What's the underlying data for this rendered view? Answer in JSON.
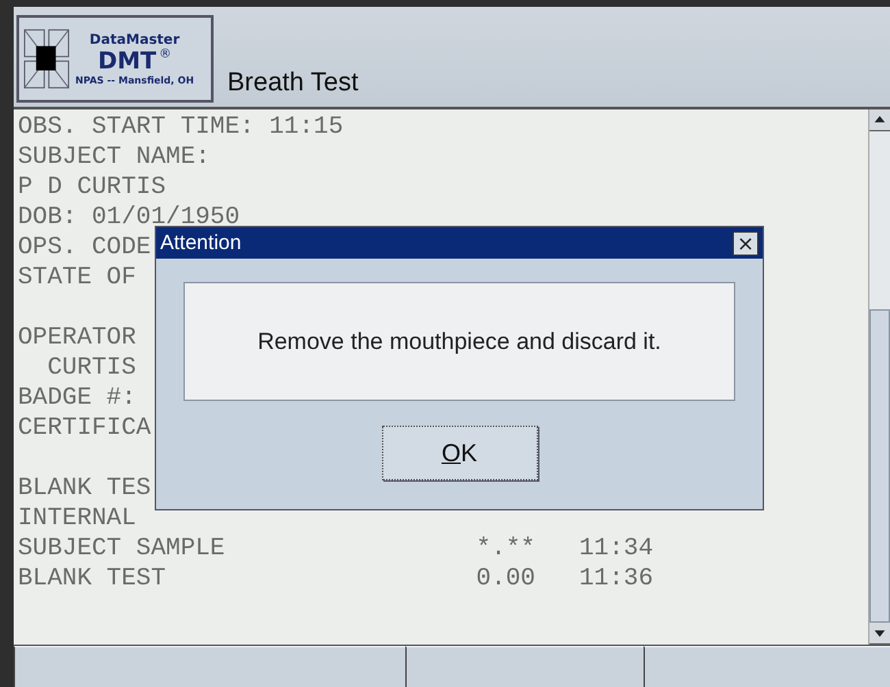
{
  "header": {
    "logo": {
      "brand": "DataMaster",
      "model": "DMT",
      "mark": "®",
      "location": "NPAS -- Mansfield, OH"
    },
    "title": "Breath Test"
  },
  "report": {
    "lines": [
      {
        "kind": "text",
        "label": "OBS. START TIME: 11:15"
      },
      {
        "kind": "text",
        "label": "SUBJECT NAME:"
      },
      {
        "kind": "text",
        "label": "P D CURTIS"
      },
      {
        "kind": "text",
        "label": "DOB: 01/01/1950"
      },
      {
        "kind": "text",
        "label": "OPS. CODE"
      },
      {
        "kind": "text",
        "label": "STATE OF"
      },
      {
        "kind": "blank"
      },
      {
        "kind": "text",
        "label": "OPERATOR"
      },
      {
        "kind": "text",
        "label": "  CURTIS"
      },
      {
        "kind": "text",
        "label": "BADGE #:"
      },
      {
        "kind": "text",
        "label": "CERTIFICA"
      },
      {
        "kind": "blank"
      },
      {
        "kind": "text",
        "label": "BLANK TES"
      },
      {
        "kind": "text",
        "label": "INTERNAL"
      },
      {
        "kind": "result",
        "label": "SUBJECT SAMPLE",
        "value": "*.**",
        "time": "11:34"
      },
      {
        "kind": "result",
        "label": "BLANK TEST",
        "value": "0.00",
        "time": "11:36"
      }
    ]
  },
  "dialog": {
    "title": "Attention",
    "close": "×",
    "message": "Remove the mouthpiece and discard it.",
    "button": "OK"
  },
  "softkeys": [
    {
      "kind": "blank"
    },
    {
      "kind": "blank"
    },
    {
      "kind": "blank"
    }
  ]
}
